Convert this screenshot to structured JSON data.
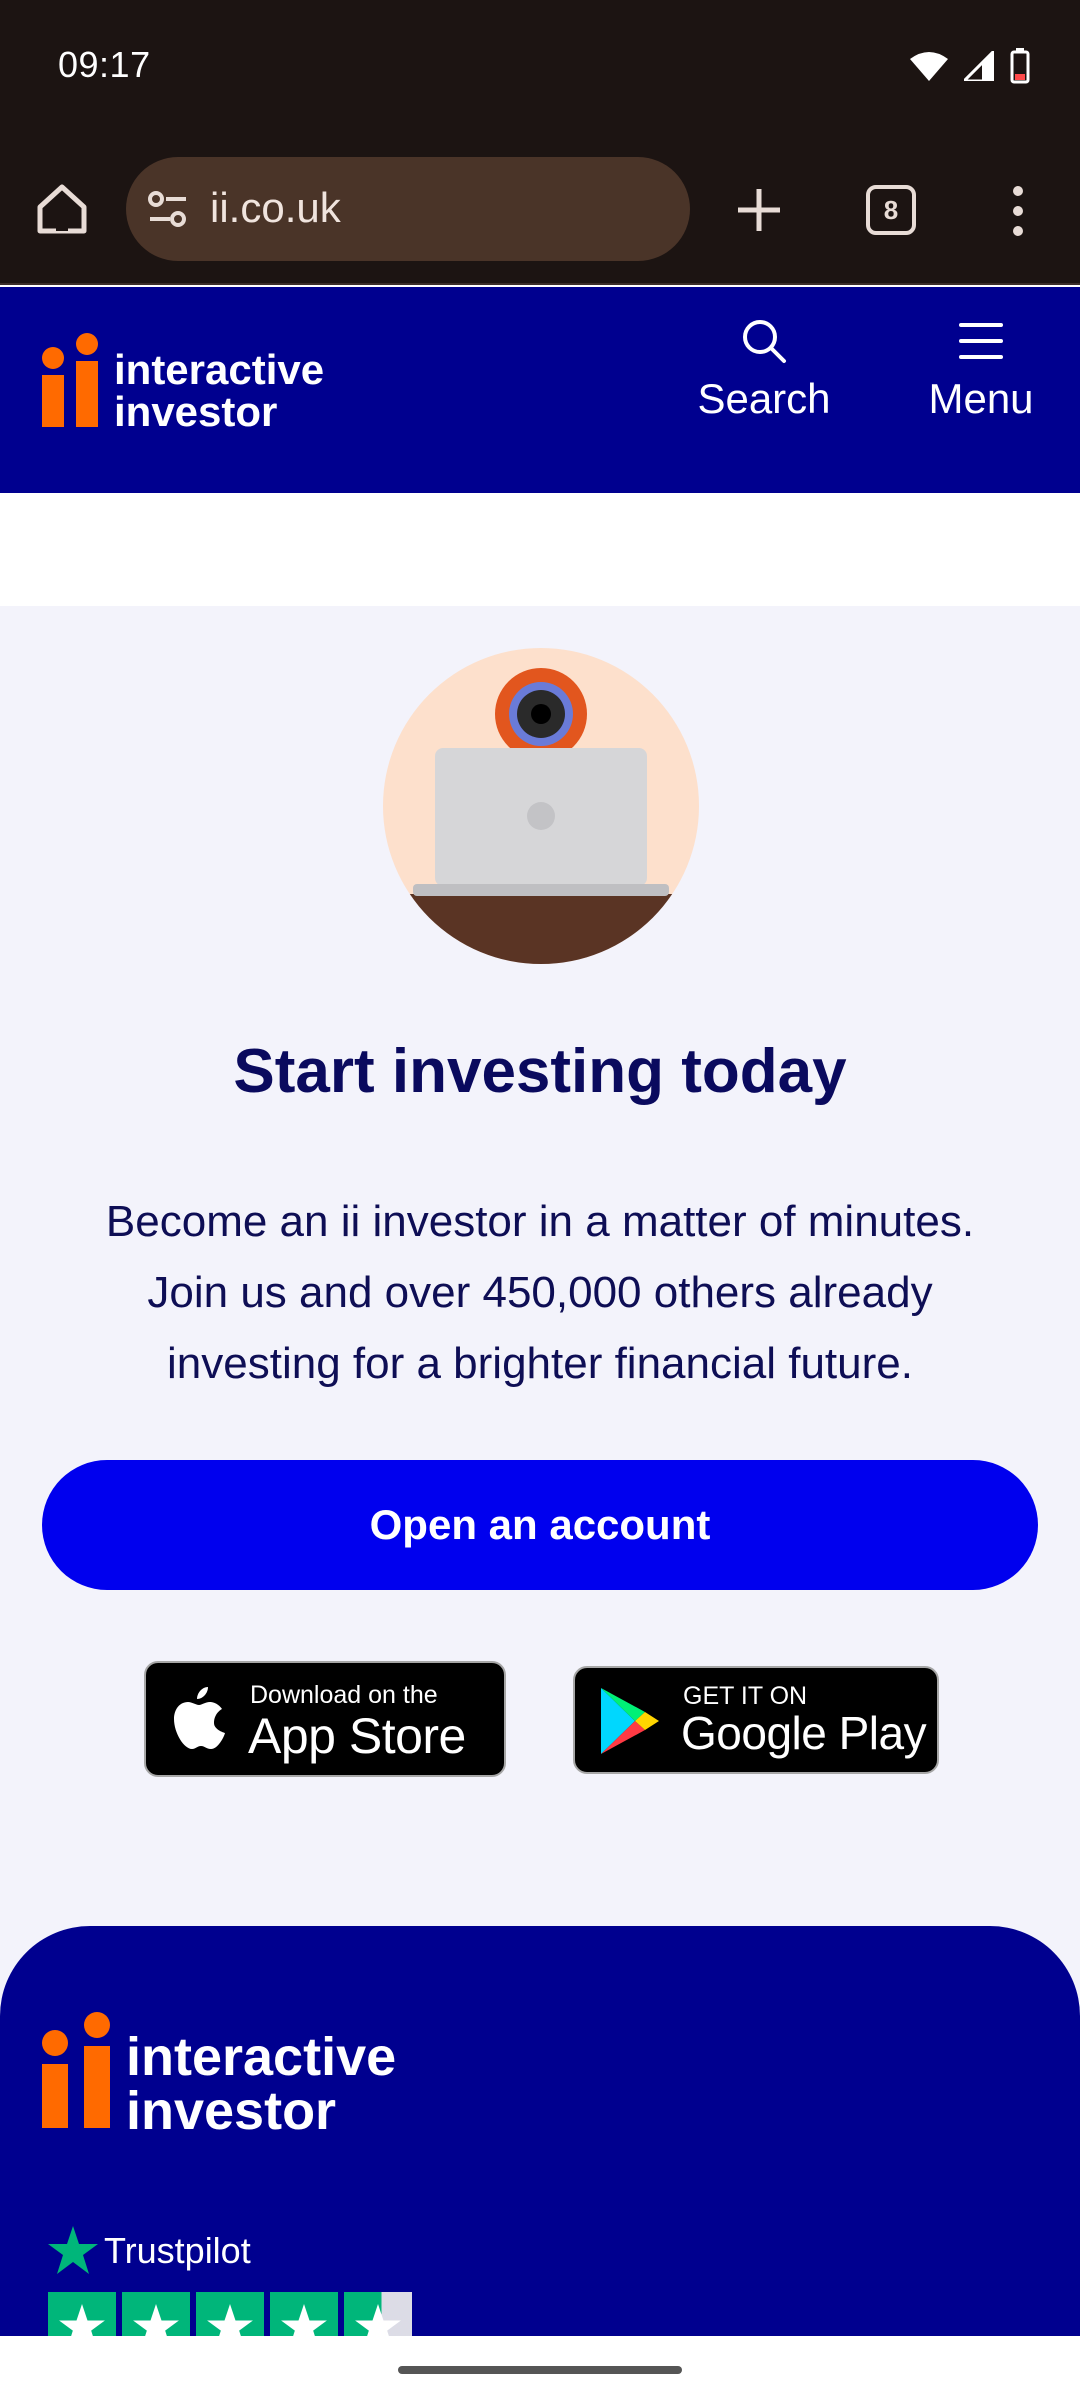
{
  "status_bar": {
    "time": "09:17"
  },
  "browser": {
    "url": "ii.co.uk",
    "tab_count": "8"
  },
  "header": {
    "logo_line1": "interactive",
    "logo_line2": "investor",
    "search_label": "Search",
    "menu_label": "Menu"
  },
  "main": {
    "headline": "Start investing today",
    "intro": "Become an ii investor in a matter of minutes. Join us and over 450,000 others already investing for a brighter financial future.",
    "cta_label": "Open an account",
    "appstore_small": "Download on the",
    "appstore_big": "App Store",
    "playstore_small": "GET IT ON",
    "playstore_big": "Google Play"
  },
  "footer": {
    "logo_line1": "interactive",
    "logo_line2": "investor",
    "trustpilot": "Trustpilot",
    "rating_stars": 4.5
  },
  "colors": {
    "brand_blue": "#00008f",
    "cta_blue": "#0000ee",
    "accent_orange": "#ff6a00",
    "trust_green": "#00b67a"
  }
}
